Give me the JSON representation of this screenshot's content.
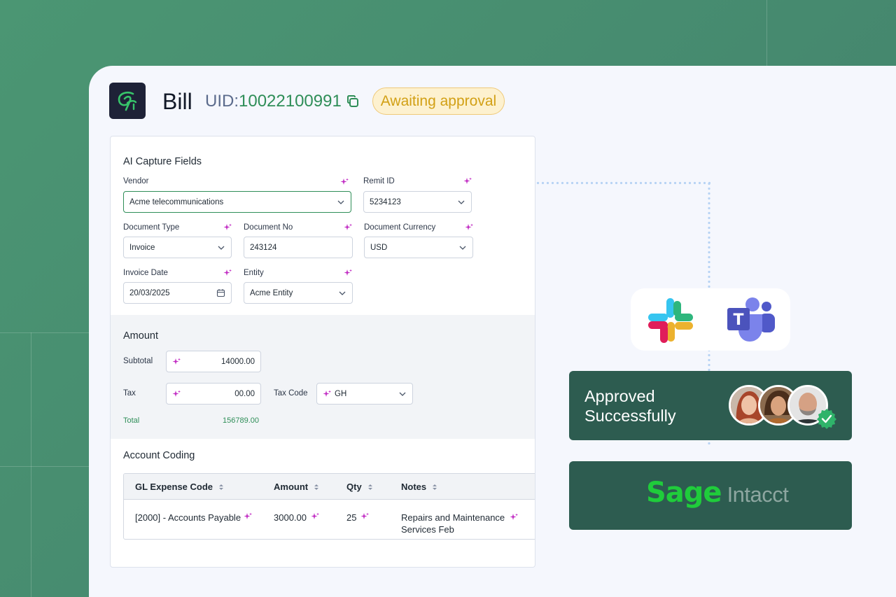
{
  "header": {
    "title": "Bill",
    "uid_prefix": "UID:",
    "uid_value": "10022100991",
    "status": "Awaiting approval",
    "status_color": "#d2a015"
  },
  "capture": {
    "section_title": "AI Capture Fields",
    "fields": {
      "vendor": {
        "label": "Vendor",
        "value": "Acme telecommunications"
      },
      "remit_id": {
        "label": "Remit ID",
        "value": "5234123"
      },
      "document_type": {
        "label": "Document Type",
        "value": "Invoice"
      },
      "document_no": {
        "label": "Document No",
        "value": "243124"
      },
      "document_currency": {
        "label": "Document Currency",
        "value": "USD"
      },
      "invoice_date": {
        "label": "Invoice Date",
        "value": "20/03/2025"
      },
      "entity": {
        "label": "Entity",
        "value": "Acme Entity"
      }
    }
  },
  "amount": {
    "section_title": "Amount",
    "subtotal_label": "Subtotal",
    "subtotal_value": "14000.00",
    "tax_label": "Tax",
    "tax_value": "00.00",
    "tax_code_label": "Tax Code",
    "tax_code_value": "GH",
    "total_label": "Total",
    "total_value": "156789.00"
  },
  "account_coding": {
    "section_title": "Account Coding",
    "columns": [
      "GL Expense Code",
      "Amount",
      "Qty",
      "Notes"
    ],
    "rows": [
      {
        "gl_code": "[2000] - Accounts Payable",
        "amount": "3000.00",
        "qty": "25",
        "notes": "Repairs and Maintenance Services Feb"
      }
    ]
  },
  "integrations": {
    "chat_apps": [
      "slack-icon",
      "teams-icon"
    ],
    "teams_letter": "T",
    "approved_text": "Approved Successfully",
    "sage_word": "Sage",
    "intacct_word": "Intacct",
    "accent_color": "#2f8e58",
    "card_color": "#2d5c50"
  }
}
